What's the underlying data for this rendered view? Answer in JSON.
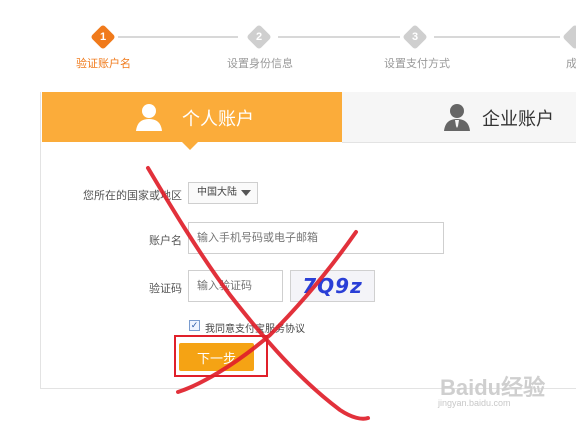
{
  "steps": [
    {
      "num": "1",
      "label": "验证账户名",
      "active": true
    },
    {
      "num": "2",
      "label": "设置身份信息",
      "active": false
    },
    {
      "num": "3",
      "label": "设置支付方式",
      "active": false
    },
    {
      "num": "",
      "label": "成",
      "active": false
    }
  ],
  "tabs": {
    "personal": "个人账户",
    "business": "企业账户"
  },
  "form": {
    "region_label": "您所在的国家或地区",
    "region_value": "中国大陆",
    "account_label": "账户名",
    "account_placeholder": "输入手机号码或电子邮箱",
    "captcha_label": "验证码",
    "captcha_placeholder": "输入验证码",
    "captcha_text": "7Q9z",
    "agree_text": "我同意支付宝服务协议",
    "next_button": "下一步"
  },
  "watermark": {
    "logo": "Baidu经验",
    "url": "jingyan.baidu.com"
  },
  "colors": {
    "accent": "#f07a1b",
    "tab_active": "#fbac3a",
    "button": "#f5a314",
    "annotation": "#e0202a"
  }
}
